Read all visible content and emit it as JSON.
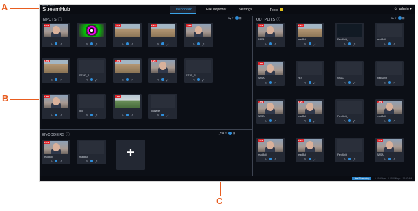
{
  "callouts": {
    "a": "A",
    "b": "B",
    "c": "C"
  },
  "brand": {
    "small": "HAIVISION",
    "name": "StreamHub"
  },
  "nav": {
    "dashboard": "Dashboard",
    "file_explorer": "File explorer",
    "settings": "Settings",
    "tools": "Tools"
  },
  "user": {
    "label": "admin"
  },
  "panels": {
    "inputs": "INPUTS",
    "outputs": "OUTPUTS",
    "encoders": "ENCODERS"
  },
  "inputs": [
    {
      "name": "",
      "thumb": "man",
      "live": true
    },
    {
      "name": "",
      "thumb": "rings",
      "live": false
    },
    {
      "name": "",
      "thumb": "desert",
      "live": true
    },
    {
      "name": "",
      "thumb": "desert",
      "live": true
    },
    {
      "name": "",
      "thumb": "man",
      "live": true
    },
    {
      "name": "",
      "thumb": "desert",
      "live": true
    },
    {
      "name": "RTMP_C",
      "thumb": "blank",
      "live": false
    },
    {
      "name": "",
      "thumb": "desert",
      "live": true
    },
    {
      "name": "",
      "thumb": "man",
      "live": true
    },
    {
      "name": "RTSP_C",
      "thumb": "blank",
      "live": false
    },
    {
      "name": "",
      "thumb": "man",
      "live": true
    },
    {
      "name": "gro",
      "thumb": "blank",
      "live": false
    },
    {
      "name": "",
      "thumb": "field",
      "live": true
    },
    {
      "name": "Available",
      "thumb": "blank",
      "live": false
    }
  ],
  "encoders": [
    {
      "name": "readBull",
      "thumb": "man",
      "live": true
    },
    {
      "name": "readBull",
      "thumb": "blank",
      "live": false
    }
  ],
  "outputs": [
    {
      "name": "NASA",
      "thumb": "man",
      "live": true
    },
    {
      "name": "readBull",
      "thumb": "desert",
      "live": true
    },
    {
      "name": "FieldUnit_",
      "thumb": "dark",
      "live": false
    },
    {
      "name": "readBull",
      "thumb": "blank",
      "live": false
    },
    {
      "name": "NASA",
      "thumb": "man",
      "live": true
    },
    {
      "name": "HLS",
      "thumb": "blank",
      "live": false
    },
    {
      "name": "NASA",
      "thumb": "blank",
      "live": false
    },
    {
      "name": "FieldUnit_",
      "thumb": "blank",
      "live": false
    },
    {
      "name": "NASA",
      "thumb": "man",
      "live": true
    },
    {
      "name": "readBull",
      "thumb": "man",
      "live": true
    },
    {
      "name": "FieldUnit_",
      "thumb": "blank",
      "live": false
    },
    {
      "name": "readBull",
      "thumb": "man",
      "live": true
    },
    {
      "name": "readBull",
      "thumb": "man",
      "live": true
    },
    {
      "name": "readBull",
      "thumb": "man",
      "live": true
    },
    {
      "name": "FieldUnit_",
      "thumb": "blank",
      "live": false
    },
    {
      "name": "NASA",
      "thumb": "man",
      "live": true
    }
  ],
  "live_label": "LIVE",
  "status": {
    "badge": "Live Streaming",
    "text1": "0 / 100 bps",
    "text2": "0 / 100 Mbps",
    "text3": "12:00 AM"
  },
  "add_label": "+"
}
